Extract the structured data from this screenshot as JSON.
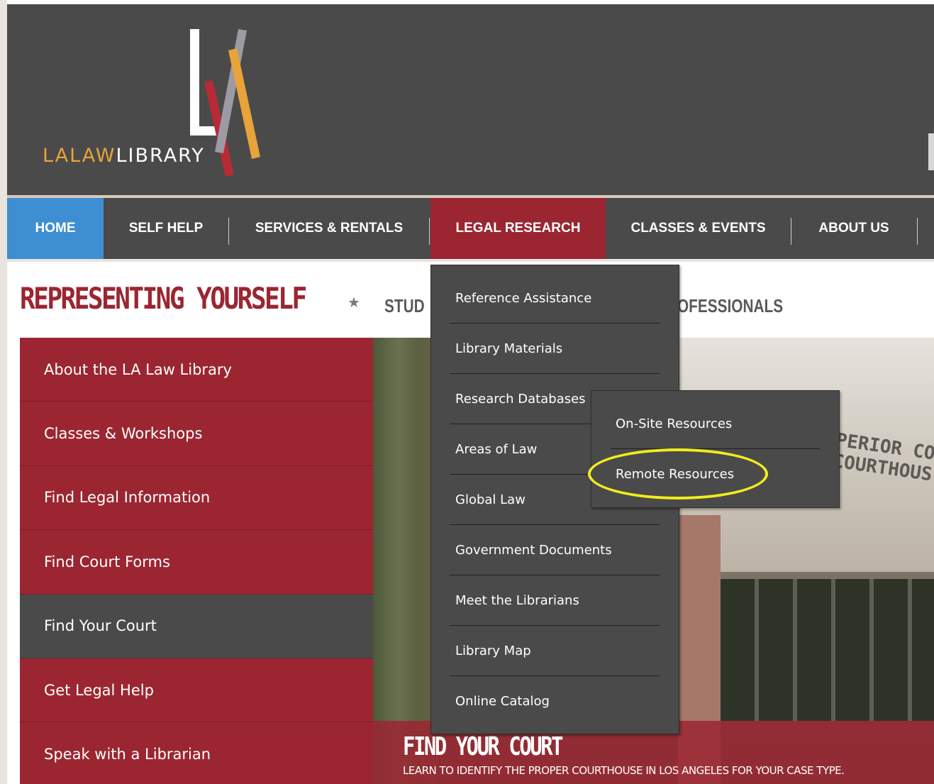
{
  "brand": {
    "logo_la": "LALAW",
    "logo_library": "LIBRARY",
    "logo_colors": {
      "bar1": "#b62b36",
      "bar2": "#9e9aa5",
      "bar3": "#e8a33a",
      "letter": "#ffffff"
    }
  },
  "nav": {
    "items": [
      {
        "label": "HOME"
      },
      {
        "label": "SELF HELP"
      },
      {
        "label": "SERVICES & RENTALS"
      },
      {
        "label": "LEGAL RESEARCH"
      },
      {
        "label": "CLASSES & EVENTS"
      },
      {
        "label": "ABOUT US"
      }
    ]
  },
  "heading": {
    "title": "REPRESENTING YOURSELF",
    "star": "★",
    "tab_students": "STUD",
    "tab_professionals": "OFESSIONALS"
  },
  "sidebar": {
    "items": [
      {
        "label": "About the LA Law Library"
      },
      {
        "label": "Classes & Workshops"
      },
      {
        "label": "Find Legal Information"
      },
      {
        "label": "Find Court Forms"
      },
      {
        "label": "Find Your Court"
      },
      {
        "label": "Get Legal Help"
      },
      {
        "label": "Speak with a Librarian"
      }
    ]
  },
  "hero": {
    "sign_line1": "PERIOR COU",
    "sign_line2": "COURTHOUS",
    "title": "FIND YOUR COURT",
    "subtitle": "LEARN TO IDENTIFY THE PROPER COURTHOUSE IN LOS ANGELES FOR YOUR CASE TYPE."
  },
  "dropdown": {
    "items": [
      {
        "label": "Reference Assistance"
      },
      {
        "label": "Library Materials"
      },
      {
        "label": "Research Databases"
      },
      {
        "label": "Areas of Law"
      },
      {
        "label": "Global Law"
      },
      {
        "label": "Government Documents"
      },
      {
        "label": "Meet the Librarians"
      },
      {
        "label": "Library Map"
      },
      {
        "label": "Online Catalog"
      }
    ]
  },
  "submenu": {
    "items": [
      {
        "label": "On-Site Resources"
      },
      {
        "label": "Remote Resources"
      }
    ]
  },
  "colors": {
    "header_bg": "#4a4a4a",
    "brand_red": "#9b2631",
    "home_blue": "#3d8fd1",
    "highlight": "#f1ec1d"
  }
}
